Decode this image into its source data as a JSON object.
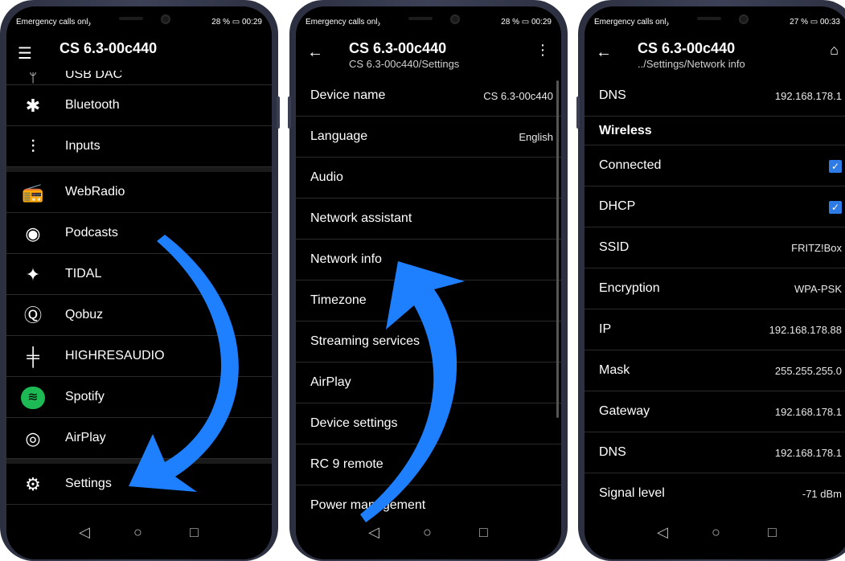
{
  "phone1": {
    "status_left": "Emergency calls only",
    "status_right": "28 % ▭ 00:29",
    "nav_icon": "hamburger-menu-icon",
    "title": "CS 6.3-00c440",
    "partial_item": "USB DAC",
    "items": [
      {
        "label": "Bluetooth",
        "icon": "bluetooth-icon",
        "glyph": "✱"
      },
      {
        "label": "Inputs",
        "icon": "inputs-icon",
        "glyph": "⫶"
      },
      {
        "label": "WebRadio",
        "icon": "radio-icon",
        "glyph": "📻"
      },
      {
        "label": "Podcasts",
        "icon": "podcast-icon",
        "glyph": "◉"
      },
      {
        "label": "TIDAL",
        "icon": "tidal-icon",
        "glyph": "✦"
      },
      {
        "label": "Qobuz",
        "icon": "qobuz-icon",
        "glyph": "Ⓠ"
      },
      {
        "label": "HIGHRESAUDIO",
        "icon": "highresaudio-icon",
        "glyph": "╪"
      },
      {
        "label": "Spotify",
        "icon": "spotify-icon",
        "glyph": "≋"
      },
      {
        "label": "AirPlay",
        "icon": "airplay-icon",
        "glyph": "◎"
      },
      {
        "label": "Settings",
        "icon": "settings-gear-icon",
        "glyph": "⚙"
      }
    ]
  },
  "phone2": {
    "status_left": "Emergency calls only",
    "status_right": "28 % ▭ 00:29",
    "nav_icon": "back-arrow-icon",
    "title": "CS 6.3-00c440",
    "subtitle": "CS 6.3-00c440/Settings",
    "action_icon": "more-vert-icon",
    "items": [
      {
        "label": "Device name",
        "value": "CS 6.3-00c440"
      },
      {
        "label": "Language",
        "value": "English"
      },
      {
        "label": "Audio",
        "value": ""
      },
      {
        "label": "Network assistant",
        "value": ""
      },
      {
        "label": "Network info",
        "value": ""
      },
      {
        "label": "Timezone",
        "value": ""
      },
      {
        "label": "Streaming services",
        "value": ""
      },
      {
        "label": "AirPlay",
        "value": ""
      },
      {
        "label": "Device settings",
        "value": ""
      },
      {
        "label": "RC 9 remote",
        "value": ""
      },
      {
        "label": "Power management",
        "value": ""
      }
    ]
  },
  "phone3": {
    "status_left": "Emergency calls only",
    "status_right": "27 % ▭ 00:33",
    "nav_icon": "back-arrow-icon",
    "title": "CS 6.3-00c440",
    "subtitle": "../Settings/Network info",
    "action_icon": "home-icon",
    "top_row": {
      "label": "DNS",
      "value": "192.168.178.1"
    },
    "section": "Wireless",
    "rows": [
      {
        "label": "Connected",
        "value": "",
        "checked": true
      },
      {
        "label": "DHCP",
        "value": "",
        "checked": true
      },
      {
        "label": "SSID",
        "value": "FRITZ!Box"
      },
      {
        "label": "Encryption",
        "value": "WPA-PSK"
      },
      {
        "label": "IP",
        "value": "192.168.178.88"
      },
      {
        "label": "Mask",
        "value": "255.255.255.0"
      },
      {
        "label": "Gateway",
        "value": "192.168.178.1"
      },
      {
        "label": "DNS",
        "value": "192.168.178.1"
      },
      {
        "label": "Signal level",
        "value": "-71 dBm"
      }
    ]
  },
  "navbar": {
    "back": "◁",
    "home": "○",
    "recents": "□"
  },
  "colors": {
    "arrow": "#1e7fff",
    "check": "#2e7be6",
    "background": "#000000"
  }
}
